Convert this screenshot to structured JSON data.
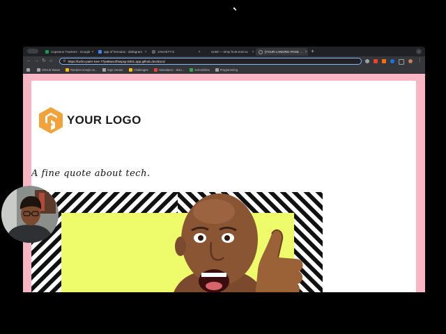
{
  "browser": {
    "tabs": [
      {
        "label": "Capstone Trackers - Google",
        "favicon_color": "#0f9d58",
        "active": false
      },
      {
        "label": "app of formulas - diafagram",
        "favicon_color": "#4285f4",
        "active": false
      },
      {
        "label": "JANAETY'S",
        "favicon_color": "#5f6368",
        "active": false
      },
      {
        "label": "Untel — trinty front-end-ov",
        "favicon_color": "#5f6368",
        "active": false
      },
      {
        "label": "[YOUR LANDING PAGE NAM",
        "favicon_color": "#9aa0a6",
        "active": true
      }
    ],
    "new_tab": "+",
    "url": "https://turbo-palm-tree-77jw96wv2f4wpxp-5501.app.github.dev/docs/",
    "bookmarks": [
      {
        "label": "GitHub Status",
        "color": "#9aa0a6"
      },
      {
        "label": "Random emojis on...",
        "color": "#fbbc04"
      },
      {
        "label": "logo creator",
        "color": "#9aa0a6"
      },
      {
        "label": "Challenges",
        "color": "#fbbc04"
      },
      {
        "label": "Attendance - Sixo...",
        "color": "#ea4335"
      },
      {
        "label": "Schoolzitna",
        "color": "#34a853"
      },
      {
        "label": "Programming",
        "color": "#9aa0a6"
      }
    ],
    "extension_colors": [
      "#ea4335",
      "#ff6d00",
      "#1a73e8",
      "#9aa0a6",
      "#9aa0a6"
    ]
  },
  "page": {
    "logo_text": "YOUR LOGO",
    "quote": "A fine quote about tech.",
    "background_color": "#f8b6c4",
    "accent_color": "#f2a23a",
    "hero_panel_color": "#eefb6a"
  }
}
